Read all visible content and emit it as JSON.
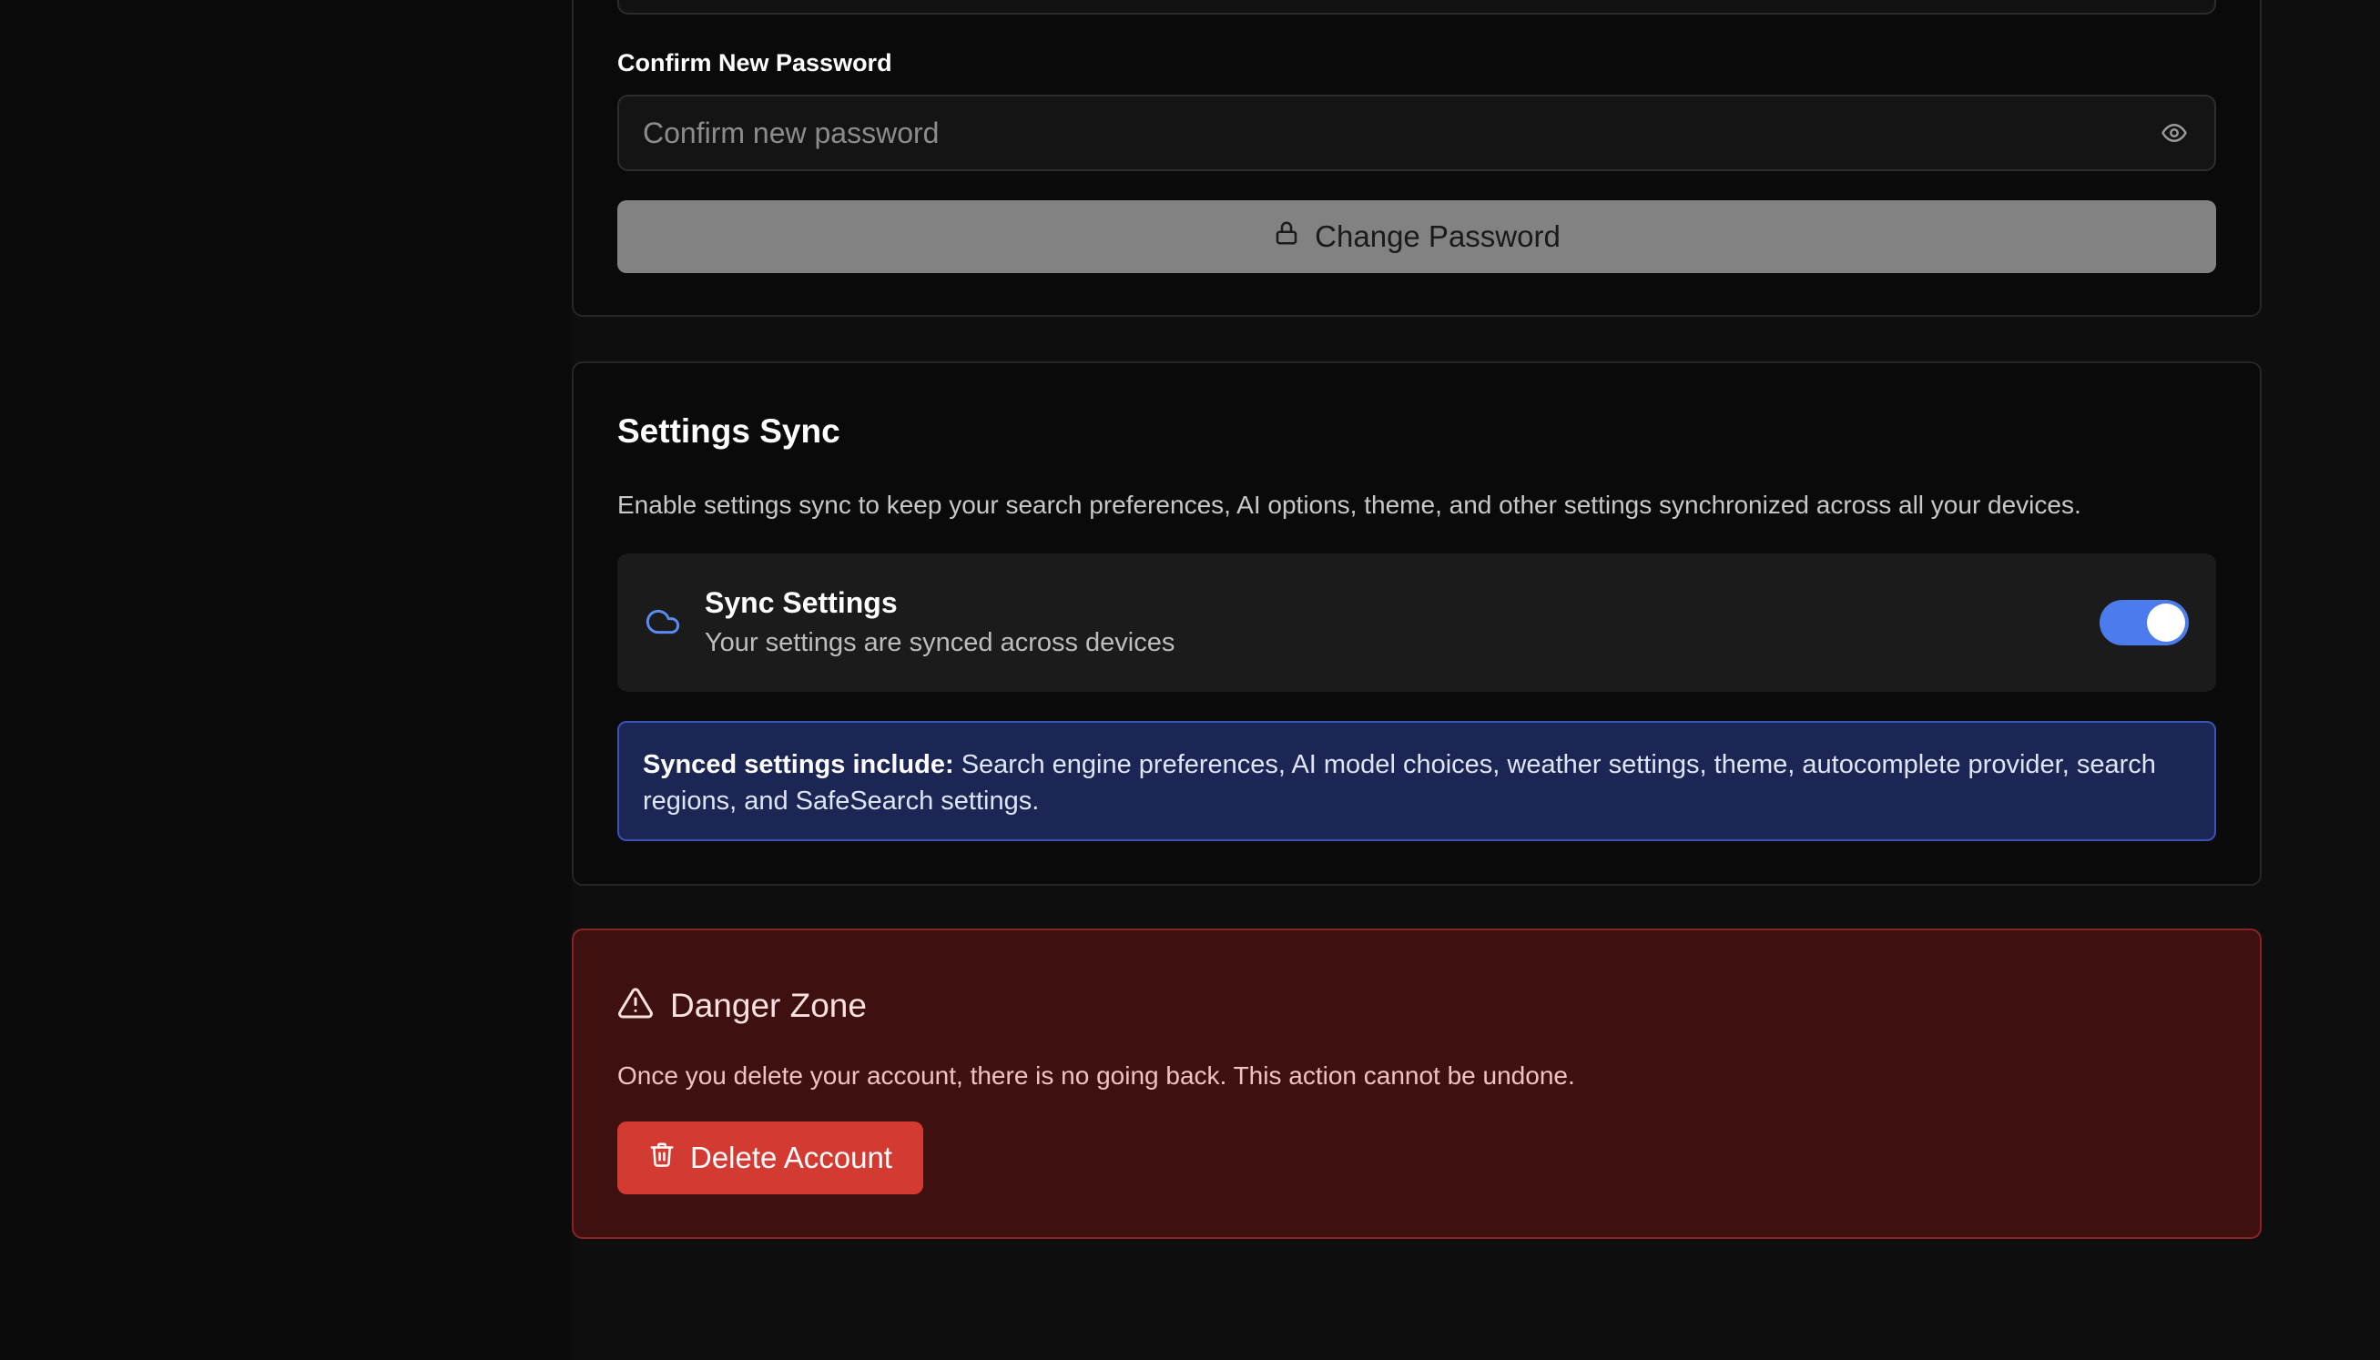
{
  "password": {
    "confirm_label": "Confirm New Password",
    "confirm_placeholder": "Confirm new password",
    "eye_icon": "eye-icon",
    "change_button": "Change Password",
    "lock_icon": "lock-icon"
  },
  "sync": {
    "title": "Settings Sync",
    "description": "Enable settings sync to keep your search preferences, AI options, theme, and other settings synchronized across all your devices.",
    "row_title": "Sync Settings",
    "row_subtitle": "Your settings are synced across devices",
    "icon": "cloud-icon",
    "enabled": true,
    "info_bold": "Synced settings include:",
    "info_text": " Search engine preferences, AI model choices, weather settings, theme, autocomplete provider, search regions, and SafeSearch settings."
  },
  "danger": {
    "title": "Danger Zone",
    "icon": "warning-icon",
    "description": "Once you delete your account, there is no going back. This action cannot be undone.",
    "delete_button": "Delete Account",
    "delete_icon": "trash-icon"
  },
  "colors": {
    "background": "#0e0e0e",
    "accent_blue": "#4b7bec",
    "danger_bg": "#3f1010",
    "danger_button": "#d23a32",
    "info_bg": "#1c2654"
  }
}
